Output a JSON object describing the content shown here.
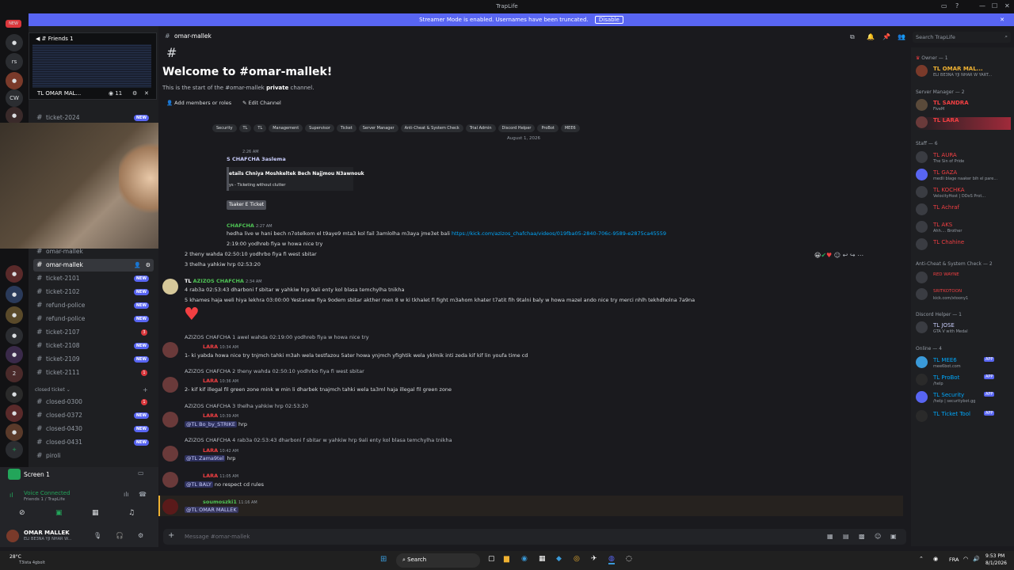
{
  "window": {
    "title": "TrapLife"
  },
  "banner": {
    "text": "Streamer Mode is enabled. Usernames have been truncated.",
    "disable_label": "Disable"
  },
  "search": {
    "placeholder": "Search TrapLife"
  },
  "channel": {
    "name": "omar-mallek",
    "welcome_title": "Welcome to #omar-mallek!",
    "welcome_sub_prefix": "This is the start of the #omar-mallek ",
    "welcome_sub_bold": "private",
    "welcome_sub_suffix": " channel.",
    "add_members": "Add members or roles",
    "edit_channel": "Edit Channel"
  },
  "roles": [
    "Security",
    "TL",
    "Management",
    "Supervisor",
    "Ticket",
    "Server Manager",
    "Anti-Cheat & System Check",
    "Trial Admin",
    "Discord Helper",
    "ProBot",
    "MEE6"
  ],
  "date_divider": "August 1, 2026",
  "popout": {
    "title": "Friends 1",
    "user": "TL OMAR MAL...",
    "viewers": "11",
    "channel": "ticket-2024"
  },
  "channels": [
    {
      "name": "ticket-2024",
      "badge": "NEW"
    },
    {
      "name": "omar-mallek",
      "badge": ""
    },
    {
      "name": "omar-mallek",
      "badge": ""
    },
    {
      "name": "ticket-2101",
      "badge": "NEW"
    },
    {
      "name": "ticket-2102",
      "badge": "NEW"
    },
    {
      "name": "refund-police",
      "badge": "NEW"
    },
    {
      "name": "refund-police",
      "badge": "NEW"
    },
    {
      "name": "ticket-2107",
      "badge": "3"
    },
    {
      "name": "ticket-2108",
      "badge": "NEW"
    },
    {
      "name": "ticket-2109",
      "badge": "NEW"
    },
    {
      "name": "ticket-2111",
      "badge": "1"
    }
  ],
  "closed_category": "closed ticket",
  "closed_channels": [
    {
      "name": "closed-0300",
      "badge": "1"
    },
    {
      "name": "closed-0372",
      "badge": "NEW"
    },
    {
      "name": "closed-0430",
      "badge": "NEW"
    },
    {
      "name": "closed-0431",
      "badge": "NEW"
    },
    {
      "name": "piroli",
      "badge": ""
    }
  ],
  "screen": {
    "label": "Screen 1"
  },
  "voice": {
    "status": "Voice Connected",
    "where": "Friends 1 / TrapLife"
  },
  "user": {
    "name": "OMAR MALLEK",
    "status": "ELI BE3NA YJI NHAR W..."
  },
  "messages": {
    "m1_time": "2:26 AM",
    "m1_name": "S CHAFCHA 3aslema",
    "m1_embed_title": "etails Chniya Moshkeltek Bech Najjmou N3awnouk",
    "m1_embed_sub": "ys - Ticketing without clutter",
    "m1_button": "Tsaker E Ticket",
    "m2_name": "CHAFCHA",
    "m2_time": "2:27 AM",
    "m2_text": "hedha live w hani bech n7otelkom el t9aye9 mta3 kol fail 3amlolha m3aya jme3et bali",
    "m2_link": "https://kick.com/azizos_chafchaa/videos/019fba05-2840-706c-9589-e2875ca45559",
    "m2_l2": "2:19:00 yodhreb fiya w howa nice try",
    "m2_l3": "2 theny wahda 02:50:10 yodhrbo fiya fi west sbitar",
    "m2_l4": "3 thelha yahkiw hrp 02:53:20",
    "m3_prefix": "TL",
    "m3_name": "AZIZOS CHAFCHA",
    "m3_time": "2:34 AM",
    "m3_l1": "4 rab3a 02:53:43 dharboni f sbitar w yahkiw hrp 9ali enty kol blasa temchylha tnikha",
    "m3_l2": "5 khames haja weli hiya lekhra 03:00:00 Yestanew fiya 9odem sbitar akther men 8 w ki tkhalet fi fight m3ahom khater t7atit fih 9talni baly w howa mazel ando nice try merci nhlh tekhdholna 7a9na",
    "r1_quote": "AZIZOS CHAFCHA 1 awel wahda 02:19:00 yodhreb fiya w howa nice try",
    "r1_name": "LARA",
    "r1_time": "10:34 AM",
    "r1_text": "1- ki yabda howa nice try tnjmch tahki m3ah wela testfazou 5ater howa ynjmch yfightik wela yklmik inti zeda kif kif lin youfa time cd",
    "r2_quote": "AZIZOS CHAFCHA 2 theny wahda 02:50:10 yodhrbo fiya fi west sbitar",
    "r2_name": "LARA",
    "r2_time": "10:36 AM",
    "r2_text": "2- kif kif illegal fil green zone mink w min li dharbek tnajmch tahki wela ta3ml haja illegal fil green zone",
    "r3_quote": "AZIZOS CHAFCHA 3 thelha yahkiw hrp 02:53:20",
    "r3_name": "LARA",
    "r3_time": "10:39 AM",
    "r3_mention": "@TL Bo_by_STRIKE",
    "r3_text": "hrp",
    "r4_quote": "AZIZOS CHAFCHA 4 rab3a 02:53:43 dharboni f sbitar w yahkiw hrp 9ali enty kol blasa temchylha tnikha",
    "r4_name": "LARA",
    "r4_time": "10:42 AM",
    "r4_mention": "@TL Zama9tel",
    "r4_text": "hrp",
    "r5_name": "LARA",
    "r5_time": "11:05 AM",
    "r5_mention": "@TL BALY",
    "r5_text": "no respect cd rules",
    "r6_name": "soumoszki1",
    "r6_time": "11:16 AM",
    "r6_mention": "@TL OMAR MALLEK"
  },
  "composer": {
    "placeholder": "Message #omar-mallek"
  },
  "members": {
    "owner_header": "Owner — 1",
    "owner": "TL OMAR MAL...",
    "owner_status": "ELI BE3NA YJI NHAR W YART...",
    "sm_header": "Server Manager — 2",
    "sm1": "TL SANDRA",
    "sm1_status": "FiveM",
    "sm2": "TL LARA",
    "staff_header": "Staff — 6",
    "staff": [
      {
        "name": "TL AURA",
        "status": "The Sin of Pride"
      },
      {
        "name": "TL GAZA",
        "status": "medli blage naaker bih el pare..."
      },
      {
        "name": "TL KOCHKA",
        "status": "VelocityHost | DDoS Prot..."
      },
      {
        "name": "TL Achraf",
        "status": ""
      },
      {
        "name": "TL AKS",
        "status": "Ahh.... Brother"
      },
      {
        "name": "TL Chahine",
        "status": ""
      }
    ],
    "ac_header": "Anti-Cheat & System Check — 2",
    "ac": [
      {
        "name": "RED WAYNE",
        "status": ""
      },
      {
        "name": "SRITKOTOON",
        "status": "kick.com/xtoony1"
      }
    ],
    "dh_header": "Discord Helper — 1",
    "dh": {
      "name": "TL JOSE",
      "status": "GTA V with Medal"
    },
    "online_header": "Online — 4",
    "bots": [
      {
        "name": "TL MEE6",
        "status": "mee6bot.com",
        "badge": "APP"
      },
      {
        "name": "TL ProBot",
        "status": "/help",
        "badge": "APP"
      },
      {
        "name": "TL Security",
        "status": "/help | securitybot.gg",
        "badge": "APP"
      },
      {
        "name": "TL Ticket Tool",
        "status": "",
        "badge": "APP"
      }
    ]
  },
  "taskbar": {
    "search": "Search",
    "weather": "28°C",
    "weather_sub": "T3ista 4gbolt",
    "lang": "FRA",
    "time": "9:53 PM",
    "date": "8/1/2026"
  },
  "colors": {
    "accent": "#5865f2",
    "danger": "#da373c",
    "online_green": "#23a55a",
    "link": "#00a8fc"
  }
}
